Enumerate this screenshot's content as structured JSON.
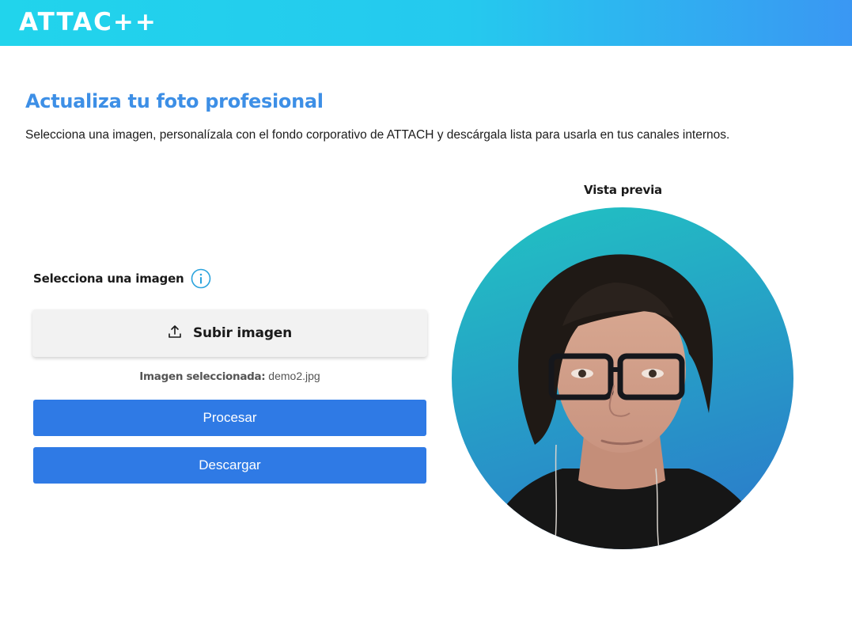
{
  "header": {
    "logo_text": "ATTAC++",
    "gradient_start": "#21d4ec",
    "gradient_end": "#3a97f3"
  },
  "main": {
    "title": "Actualiza tu foto profesional",
    "description": "Selecciona una imagen, personalízala con el fondo corporativo de ATTACH y descárgala lista para usarla en tus canales internos.",
    "title_color": "#3d8fe6"
  },
  "form": {
    "select_label": "Selecciona una imagen",
    "info_icon": "info-icon",
    "upload_icon": "upload-icon",
    "upload_label": "Subir imagen",
    "selected_prefix": "Imagen seleccionada:",
    "selected_filename": "demo2.jpg",
    "process_label": "Procesar",
    "download_label": "Descargar",
    "button_color": "#2f7ae5"
  },
  "preview": {
    "label": "Vista previa",
    "background_top": "#22c2c4",
    "background_bottom": "#2a86cc"
  }
}
